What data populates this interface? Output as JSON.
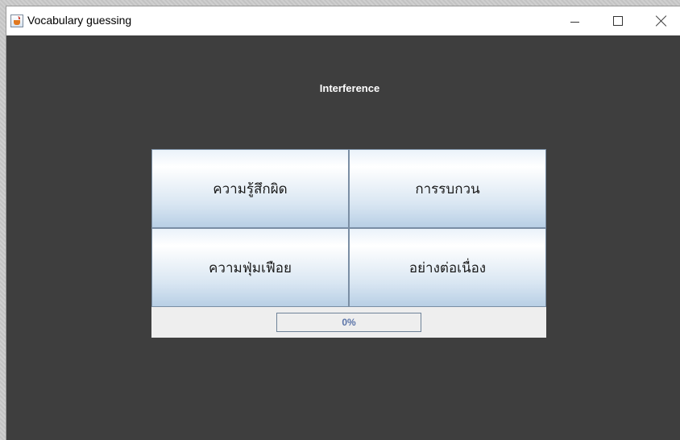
{
  "window": {
    "title": "Vocabulary guessing",
    "icon": "java-coffee-cup-icon",
    "controls": {
      "minimize": "minimize-icon",
      "maximize": "maximize-icon",
      "close": "close-icon"
    }
  },
  "quiz": {
    "word": "Interference",
    "choices": [
      {
        "label": "ความรู้สึกผิด"
      },
      {
        "label": "การรบกวน"
      },
      {
        "label": "ความฟุ่มเฟือย"
      },
      {
        "label": "อย่างต่อเนื่อง"
      }
    ],
    "progress": {
      "value": 0,
      "label": "0%"
    }
  },
  "colors": {
    "background": "#3e3e3e",
    "button_gradient_top": "#ffffff",
    "button_gradient_bottom": "#b8cfe5",
    "progress_text": "#5b74a8"
  }
}
